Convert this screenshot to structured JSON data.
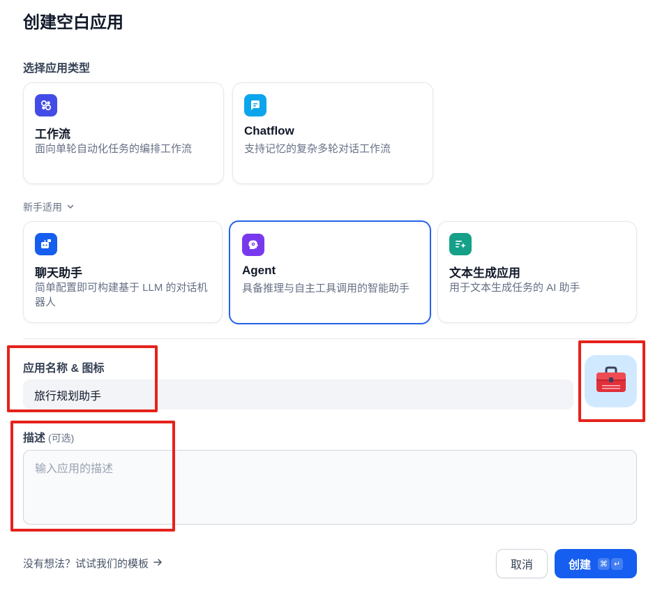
{
  "page_title": "创建空白应用",
  "app_type_section": {
    "title": "选择应用类型"
  },
  "primary_types": [
    {
      "name": "工作流",
      "desc": "面向单轮自动化任务的编排工作流",
      "icon": "workflow-icon",
      "color": "#444ce7"
    },
    {
      "name": "Chatflow",
      "desc": "支持记忆的复杂多轮对话工作流",
      "icon": "chatflow-icon",
      "color": "#0ba5ec"
    }
  ],
  "beginner": {
    "label": "新手适用"
  },
  "beginner_types": [
    {
      "name": "聊天助手",
      "desc": "简单配置即可构建基于 LLM 的对话机器人",
      "icon": "chatbot-icon",
      "color": "#155eef"
    },
    {
      "name": "Agent",
      "desc": "具备推理与自主工具调用的智能助手",
      "icon": "agent-icon",
      "color": "#7839ee",
      "selected": true
    },
    {
      "name": "文本生成应用",
      "desc": "用于文本生成任务的 AI 助手",
      "icon": "text-generation-icon",
      "color": "#15a088"
    }
  ],
  "name_field": {
    "label": "应用名称 & 图标",
    "value": "旅行规划助手"
  },
  "app_icon": {
    "icon": "toolbox-icon",
    "background": "#d1e9ff"
  },
  "desc_field": {
    "label": "描述",
    "optional": "(可选)",
    "placeholder": "输入应用的描述"
  },
  "footer": {
    "template_link": "没有想法？试试我们的模板",
    "cancel": "取消",
    "create": "创建",
    "shortcut_cmd": "⌘",
    "shortcut_enter": "↵"
  },
  "colors": {
    "accent": "#155eef",
    "highlight": "#e5221c"
  }
}
